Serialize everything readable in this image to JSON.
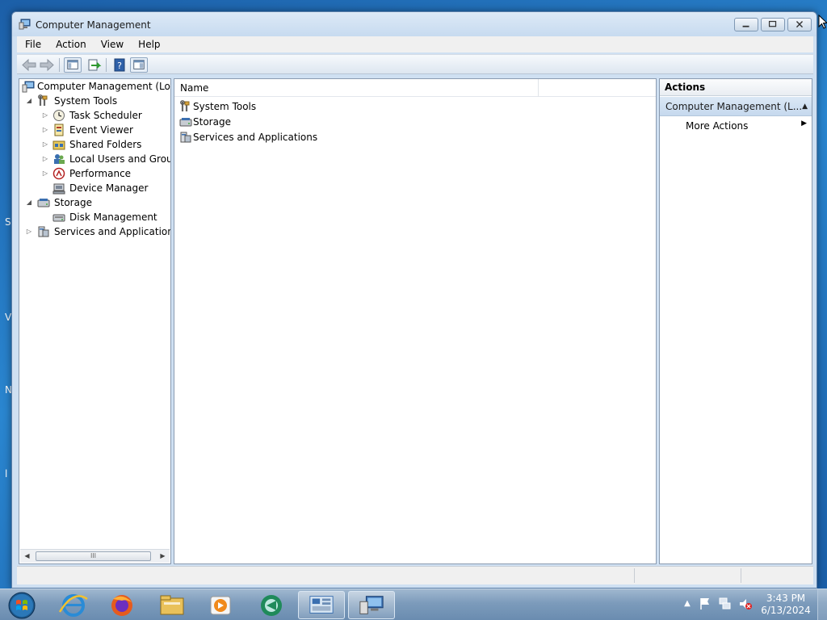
{
  "window": {
    "title": "Computer Management",
    "controls": [
      "minimize",
      "maximize",
      "close"
    ]
  },
  "menubar": {
    "items": [
      "File",
      "Action",
      "View",
      "Help"
    ]
  },
  "toolbar": {
    "buttons": [
      "back-icon",
      "forward-icon",
      "show-hide-console-tree-icon",
      "export-list-icon",
      "help-icon",
      "show-hide-action-pane-icon"
    ]
  },
  "tree": {
    "root": "Computer Management (Local",
    "items": [
      {
        "label": "System Tools",
        "expanded": true
      },
      {
        "label": "Task Scheduler"
      },
      {
        "label": "Event Viewer"
      },
      {
        "label": "Shared Folders"
      },
      {
        "label": "Local Users and Groups"
      },
      {
        "label": "Performance"
      },
      {
        "label": "Device Manager"
      },
      {
        "label": "Storage",
        "expanded": true
      },
      {
        "label": "Disk Management"
      },
      {
        "label": "Services and Applications"
      }
    ],
    "scroll_thumb": "III"
  },
  "list": {
    "columns": [
      "Name"
    ],
    "rows": [
      "System Tools",
      "Storage",
      "Services and Applications"
    ]
  },
  "actions": {
    "header": "Actions",
    "section": "Computer Management (L...",
    "items": [
      "More Actions"
    ]
  },
  "taskbar": {
    "apps": [
      "internet-explorer",
      "firefox",
      "file-explorer",
      "media-player",
      "app-circle",
      "control-panel",
      "computer-management"
    ],
    "clock": {
      "time": "3:43 PM",
      "date": "6/13/2024"
    }
  },
  "colors": {
    "desktop": "#1c5fa8",
    "window_frame": "#cfe0f2",
    "action_section": "#c6d9ee",
    "taskbar": "#7c9bbb"
  }
}
